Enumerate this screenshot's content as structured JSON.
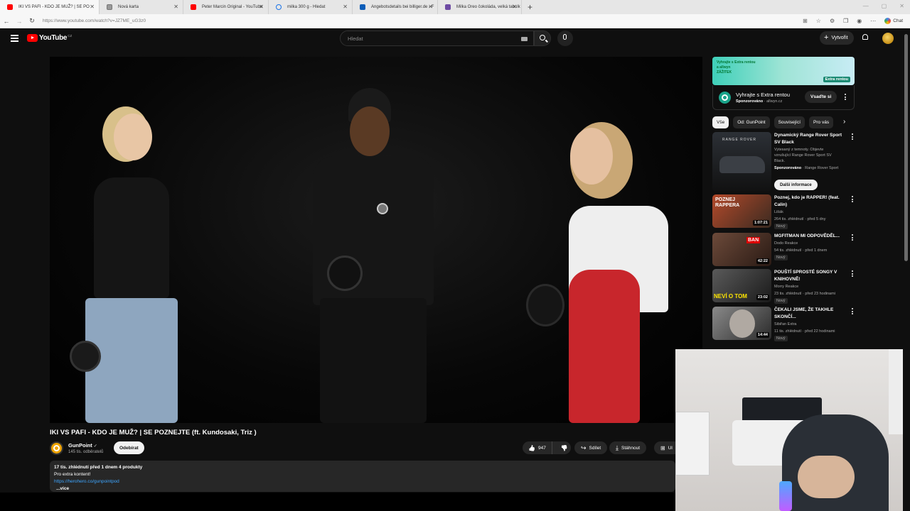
{
  "browser": {
    "tabs": [
      {
        "title": "IKI VS PAFI - KDO JE MUŽ? | SE PO",
        "favicon_color": "#ff0000",
        "active": true
      },
      {
        "title": "Nová karta",
        "favicon_color": "#888888",
        "active": false
      },
      {
        "title": "Peter Marcin Original - YouTube",
        "favicon_color": "#ff0000",
        "active": false
      },
      {
        "title": "milka 300 g - Hledat",
        "favicon_color": "#1a73e8",
        "active": false
      },
      {
        "title": "Angebotsdetails bei billiger.de - F",
        "favicon_color": "#0c5db8",
        "active": false
      },
      {
        "title": "Milka Oreo čokoláda, velká tabulk",
        "favicon_color": "#6d4aa3",
        "active": false
      }
    ],
    "new_tab_label": "+",
    "url": "https://www.youtube.com/watch?v=JZ7ME_uG3z0",
    "chat_label": "Chat"
  },
  "youtube": {
    "logo_text": "YouTube",
    "logo_country": "CZ",
    "search_placeholder": "Hledat",
    "create_label": "Vytvořit"
  },
  "video": {
    "title": "IKI VS PAFI - KDO JE MUŽ? | SE POZNEJTE (ft. Kundosaki, Triz )",
    "channel": "GunPoint",
    "verified_icon": "✓",
    "subscribers": "145 tis. odběratelů",
    "subscribe_label": "Odebírat",
    "likes": "947",
    "share_label": "Sdílet",
    "download_label": "Stáhnout",
    "save_label": "Ul",
    "description": {
      "stats": "17 tis. zhlédnutí  před 1 dnem  4 produkty",
      "line1": "Pro extra kontent!",
      "link": "https://herohero.co/gunpointpod",
      "more": "...více"
    }
  },
  "ad": {
    "banner_text_1": "Vyhrajte s Extra rentou",
    "banner_text_2": "a allwyn",
    "banner_text_3": "ZÁŽITEK",
    "banner_brand": "Extra rentou",
    "title": "Vyhrajte s Extra rentou",
    "sponsored": "Sponzorováno",
    "domain": "· allwyn.cz",
    "cta": "Vsaďte si"
  },
  "chips": [
    "Vše",
    "Od: GunPoint",
    "Související",
    "Pro vás"
  ],
  "recommendations": [
    {
      "title": "Dynamický Range Rover Sport SV Black",
      "meta1": "Vytesaný z temnoty. Objevte",
      "meta2": "vzrušující Range Rover Sport SV",
      "meta3": "Black.",
      "sponsor": "Sponzorováno",
      "sponsor_name": "· Range Rover Sport",
      "cta": "Další informace",
      "thumb_text": "RANGE ROVER"
    },
    {
      "title": "Poznej, kdo je RAPPER! (feat. Calin)",
      "channel": "Lišák",
      "meta": "264 tis. zhlédnutí · před 5 dny",
      "badge": "Nový",
      "duration": "1:07:21",
      "thumb_text": "POZNEJ RAPPERA"
    },
    {
      "title": "MGFITMAN MI ODPOVĚDĚL...",
      "channel": "Dodo Reakce",
      "meta": "54 tis. zhlédnutí · před 1 dnem",
      "badge": "Nový",
      "duration": "42:22",
      "thumb_text": "BAN"
    },
    {
      "title": "POUŠTÍ SPROSTÉ SONGY V KNIHOVNĚ!",
      "channel": "Morry Reakce",
      "meta": "23 tis. zhlédnutí · před 23 hodinami",
      "badge": "Nový",
      "duration": "23:02",
      "thumb_text": "NEVÍ O TOM"
    },
    {
      "title": "ČEKALI JSME, ŽE TAKHLE SKONČÍ...",
      "channel": "Sibiřan Extra",
      "meta": "11 tis. zhlédnutí · před 22 hodinami",
      "badge": "Nový",
      "duration": "14:44",
      "thumb_text": ""
    }
  ],
  "icons": {
    "back": "←",
    "forward": "→",
    "reload": "↻",
    "chevron_right": "›",
    "like": "👍",
    "dislike": "👎",
    "share": "↪",
    "download": "⤓",
    "save": "⊞"
  }
}
